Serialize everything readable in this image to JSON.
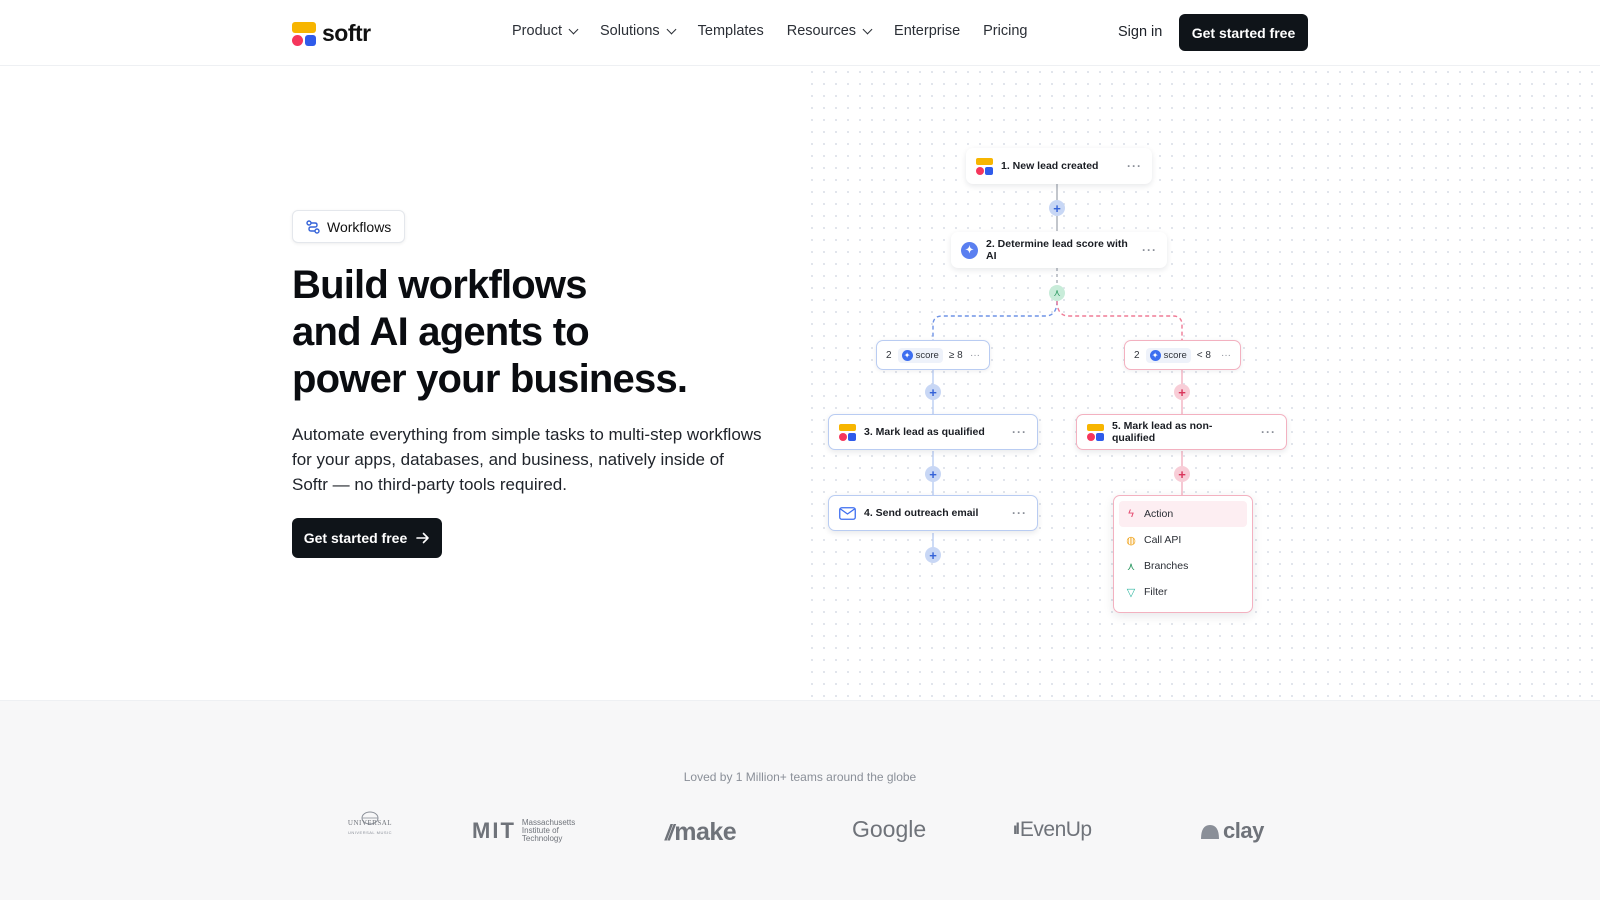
{
  "header": {
    "logo_text": "softr",
    "nav": [
      {
        "label": "Product",
        "has_dropdown": true
      },
      {
        "label": "Solutions",
        "has_dropdown": true
      },
      {
        "label": "Templates",
        "has_dropdown": false
      },
      {
        "label": "Resources",
        "has_dropdown": true
      },
      {
        "label": "Enterprise",
        "has_dropdown": false
      },
      {
        "label": "Pricing",
        "has_dropdown": false
      }
    ],
    "sign_in": "Sign in",
    "cta": "Get started free"
  },
  "hero": {
    "badge": "Workflows",
    "title_lines": [
      "Build workflows",
      "and AI agents to",
      "power your business."
    ],
    "subtitle": "Automate everything from simple tasks to multi-step workflows for your apps, databases, and business, natively inside of Softr — no third-party tools required.",
    "cta": "Get started free"
  },
  "workflow": {
    "steps": {
      "s1": "1. New lead created",
      "s2": "2. Determine lead score with AI",
      "s3": "3. Mark lead as qualified",
      "s4": "4. Send outreach email",
      "s5": "5. Mark lead as non-qualified"
    },
    "conditions": {
      "left": {
        "num": "2",
        "field": "score",
        "op": "≥ 8"
      },
      "right": {
        "num": "2",
        "field": "score",
        "op": "< 8"
      }
    },
    "menu": [
      "Action",
      "Call API",
      "Branches",
      "Filter"
    ]
  },
  "social_proof": {
    "text": "Loved by 1 Million+ teams around the globe",
    "brands": {
      "universal": "UNIVERSAL",
      "universal_sub": "UNIVERSAL MUSIC",
      "mit": "MIT",
      "mit_sub": [
        "Massachusetts",
        "Institute of",
        "Technology"
      ],
      "make": "make",
      "google": "Google",
      "evenup": "EvenUp",
      "clay": "clay"
    }
  },
  "colors": {
    "dark_button": "#0f1419",
    "blue_branch": "#b9ccf2",
    "pink_branch": "#f3b1c0",
    "logo_yellow": "#f7b500",
    "logo_red": "#f5365c",
    "logo_blue": "#2f5bea"
  }
}
